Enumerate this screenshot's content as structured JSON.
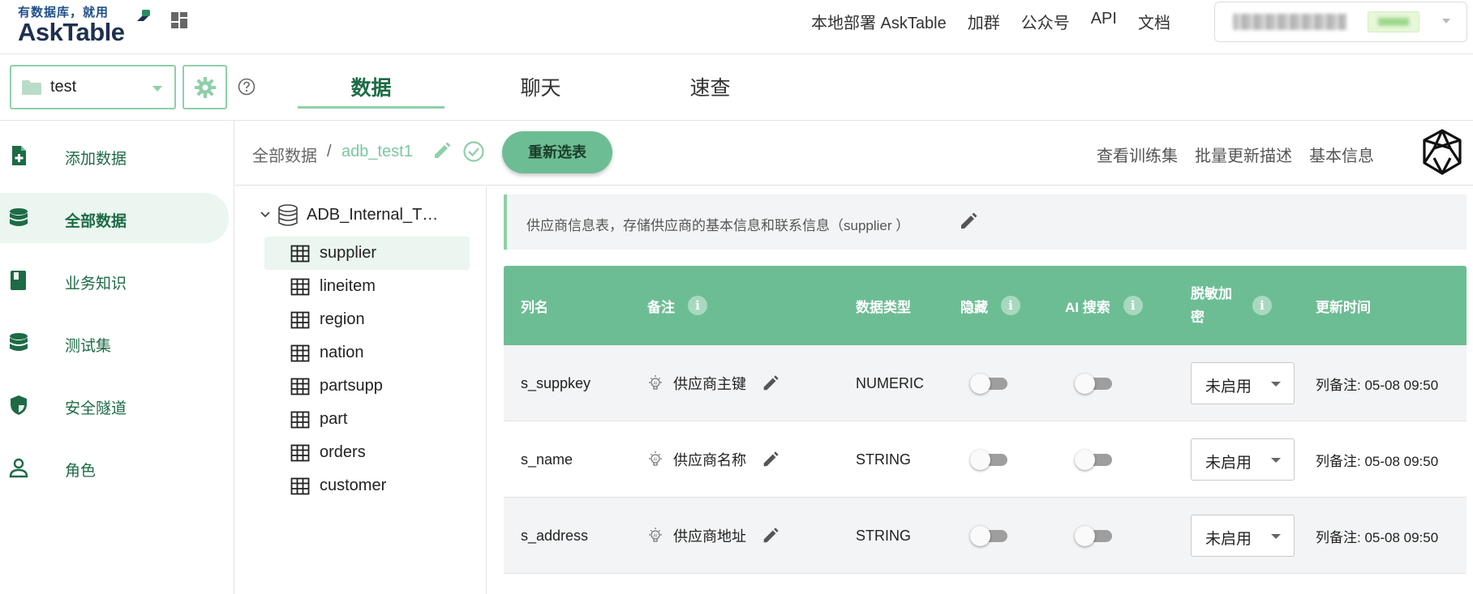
{
  "brand": {
    "tagline": "有数据库，就用",
    "name": "AskTable"
  },
  "topnav": [
    "本地部署 AskTable",
    "加群",
    "公众号",
    "API",
    "文档"
  ],
  "datasource": {
    "name": "test"
  },
  "tabs": [
    {
      "label": "数据",
      "active": true
    },
    {
      "label": "聊天",
      "active": false
    },
    {
      "label": "速查",
      "active": false
    }
  ],
  "sidebar": {
    "items": [
      {
        "label": "添加数据",
        "icon": "add-file-icon",
        "active": false
      },
      {
        "label": "全部数据",
        "icon": "database-icon",
        "active": true
      },
      {
        "label": "业务知识",
        "icon": "book-icon",
        "active": false
      },
      {
        "label": "测试集",
        "icon": "database-icon",
        "active": false
      },
      {
        "label": "安全隧道",
        "icon": "shield-icon",
        "active": false
      },
      {
        "label": "角色",
        "icon": "person-icon",
        "active": false
      }
    ]
  },
  "breadcrumb": {
    "root": "全部数据",
    "separator": "/",
    "current": "adb_test1"
  },
  "toolbar": {
    "reselect": "重新选表",
    "links": [
      "查看训练集",
      "批量更新描述",
      "基本信息"
    ]
  },
  "tree": {
    "root": "ADB_Internal_T…",
    "tables": [
      "supplier",
      "lineitem",
      "region",
      "nation",
      "partsupp",
      "part",
      "orders",
      "customer"
    ],
    "selected": "supplier"
  },
  "table_description": "供应商信息表，存储供应商的基本信息和联系信息（supplier ）",
  "columns_table": {
    "headers": {
      "name": "列名",
      "note": "备注",
      "type": "数据类型",
      "hidden": "隐藏",
      "ai_search": "AI 搜索",
      "mask_line1": "脱敏加",
      "mask_line2": "密",
      "updated": "更新时间"
    },
    "rows": [
      {
        "name": "s_suppkey",
        "note": "供应商主键",
        "type": "NUMERIC",
        "hidden": false,
        "ai_search": false,
        "mask": "未启用",
        "updated": "列备注: 05-08 09:50"
      },
      {
        "name": "s_name",
        "note": "供应商名称",
        "type": "STRING",
        "hidden": false,
        "ai_search": false,
        "mask": "未启用",
        "updated": "列备注: 05-08 09:50"
      },
      {
        "name": "s_address",
        "note": "供应商地址",
        "type": "STRING",
        "hidden": false,
        "ai_search": false,
        "mask": "未启用",
        "updated": "列备注: 05-08 09:50"
      }
    ]
  },
  "colors": {
    "accent": "#6dbd94",
    "accent_light": "#8fcfaa",
    "accent_dark": "#1d6b45",
    "selected_bg": "#eaf6ef"
  }
}
